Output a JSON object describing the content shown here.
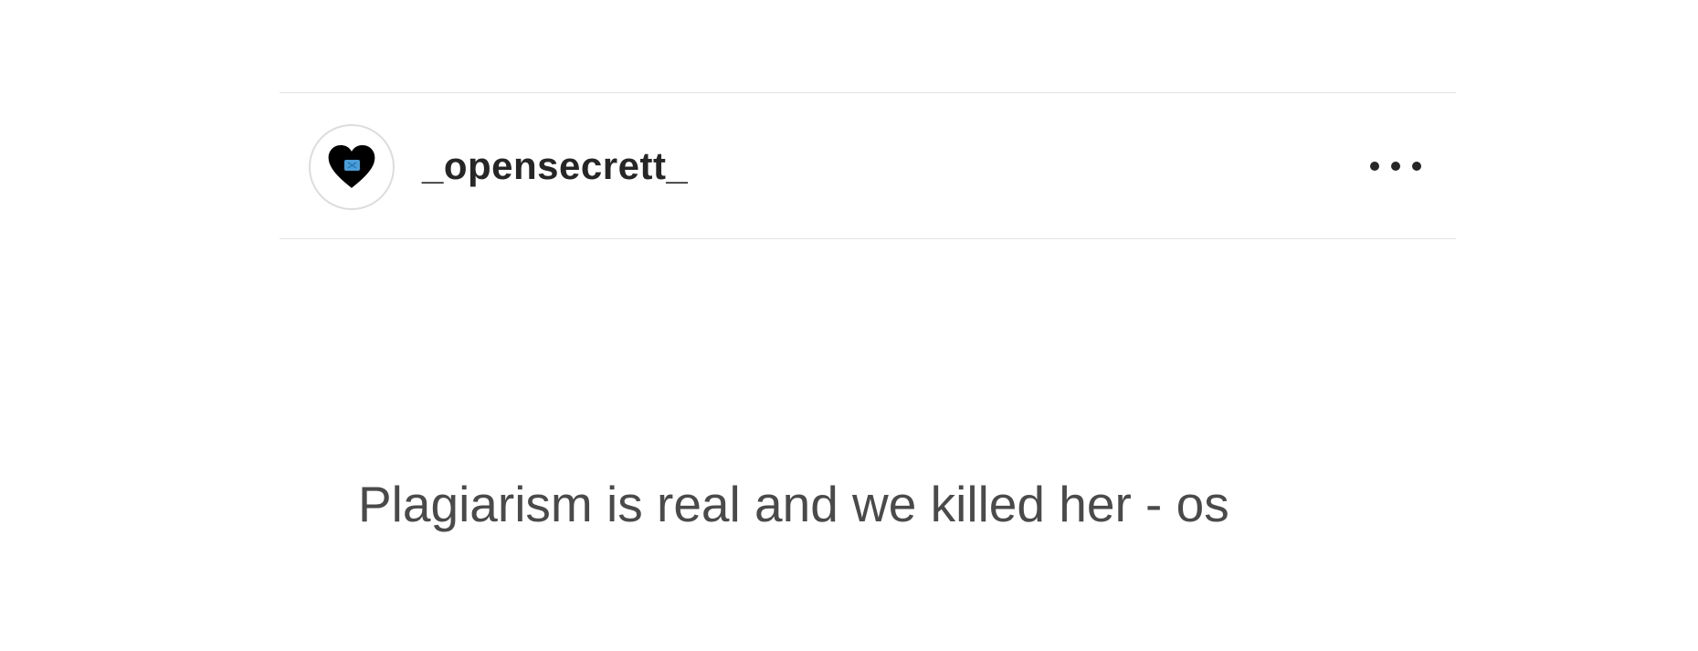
{
  "post": {
    "username": "_opensecrett_",
    "avatar_icon": "heart-icon",
    "more_icon": "more-options-icon",
    "caption": "Plagiarism is real and we killed her - os"
  }
}
